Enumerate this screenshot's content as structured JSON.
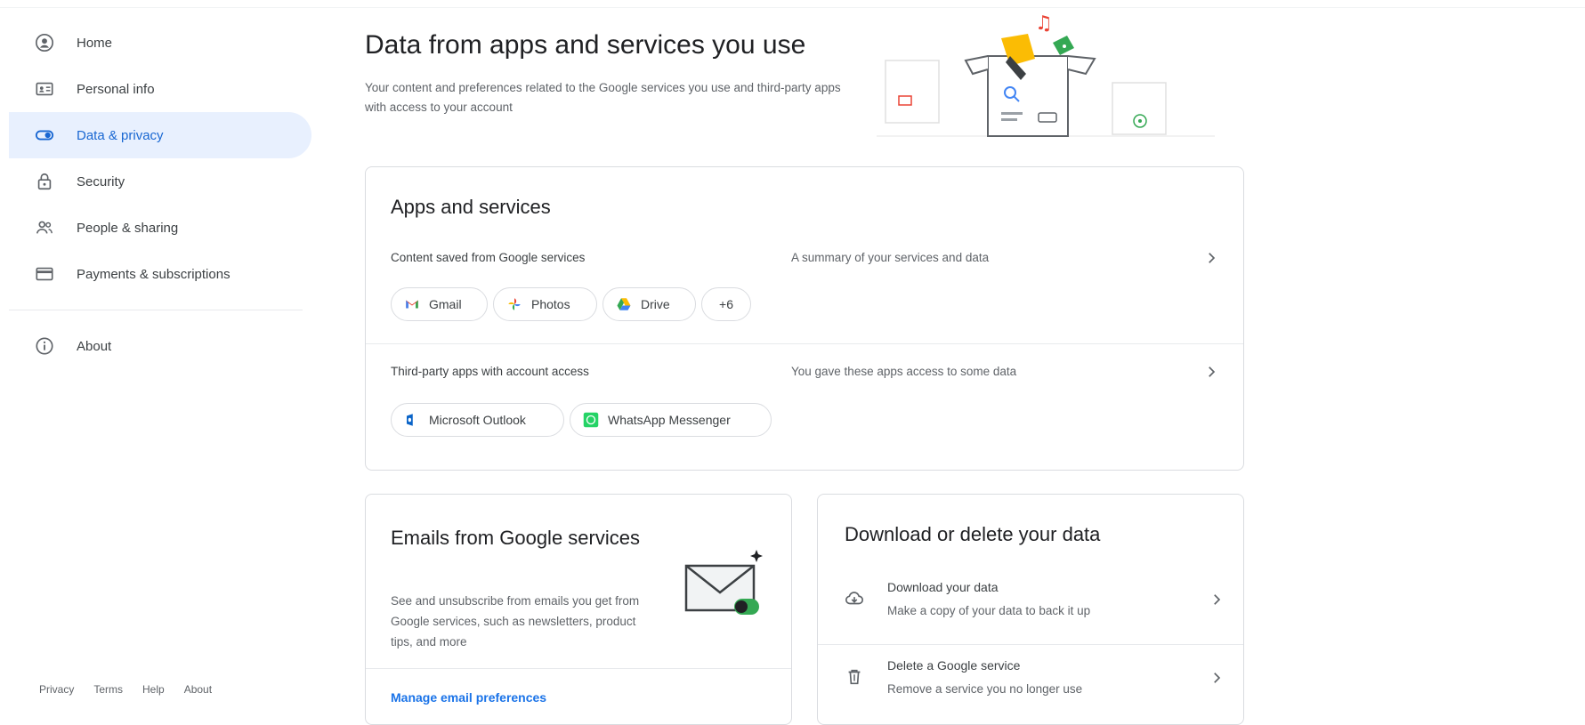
{
  "sidebar": {
    "items": [
      {
        "label": "Home",
        "icon": "home-icon"
      },
      {
        "label": "Personal info",
        "icon": "person-card-icon"
      },
      {
        "label": "Data & privacy",
        "icon": "toggle-icon",
        "active": true
      },
      {
        "label": "Security",
        "icon": "lock-icon"
      },
      {
        "label": "People & sharing",
        "icon": "people-icon"
      },
      {
        "label": "Payments & subscriptions",
        "icon": "credit-card-icon"
      }
    ],
    "about": {
      "label": "About",
      "icon": "info-icon"
    },
    "footer": [
      "Privacy",
      "Terms",
      "Help",
      "About"
    ]
  },
  "header": {
    "title": "Data from apps and services you use",
    "subtitle": "Your content and preferences related to the Google services you use and third-party apps with access to your account"
  },
  "apps_card": {
    "title": "Apps and services",
    "google_services": {
      "label": "Content saved from Google services",
      "description": "A summary of your services and data",
      "chips": [
        {
          "label": "Gmail",
          "icon": "gmail-icon"
        },
        {
          "label": "Photos",
          "icon": "photos-icon"
        },
        {
          "label": "Drive",
          "icon": "drive-icon"
        },
        {
          "label": "+6",
          "icon": ""
        }
      ]
    },
    "third_party": {
      "label": "Third-party apps with account access",
      "description": "You gave these apps access to some data",
      "chips": [
        {
          "label": "Microsoft Outlook",
          "icon": "outlook-icon"
        },
        {
          "label": "WhatsApp Messenger",
          "icon": "whatsapp-icon"
        }
      ]
    }
  },
  "emails_card": {
    "title": "Emails from Google services",
    "description": "See and unsubscribe from emails you get from Google services, such as newsletters, product tips, and more",
    "link": "Manage email preferences"
  },
  "download_card": {
    "title": "Download or delete your data",
    "rows": [
      {
        "label": "Download your data",
        "description": "Make a copy of your data to back it up",
        "icon": "cloud-download-icon"
      },
      {
        "label": "Delete a Google service",
        "description": "Remove a service you no longer use",
        "icon": "trash-icon"
      }
    ]
  },
  "colors": {
    "active_bg": "#e8f0fe",
    "active_text": "#1967d2",
    "link": "#1a73e8",
    "border": "#dadce0"
  }
}
